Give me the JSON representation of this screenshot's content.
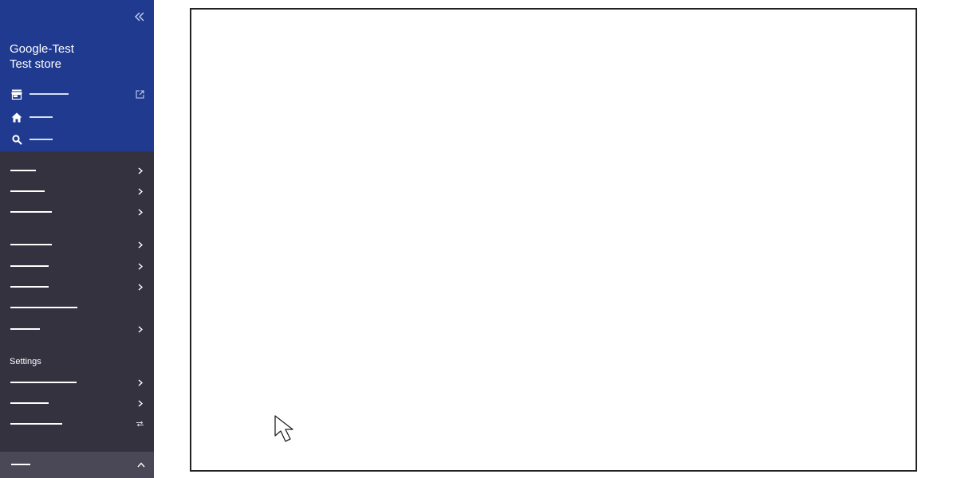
{
  "sidebar": {
    "store": {
      "line1": "Google-Test",
      "line2": "Test store"
    },
    "top_items": [
      {
        "icon": "store-icon",
        "external": true
      },
      {
        "icon": "home-icon"
      },
      {
        "icon": "search-icon"
      }
    ],
    "settings_label": "Settings",
    "colors": {
      "header_bg": "#1f3a8f",
      "body_bg": "#35323f",
      "footer_bg": "#4a4756"
    }
  }
}
